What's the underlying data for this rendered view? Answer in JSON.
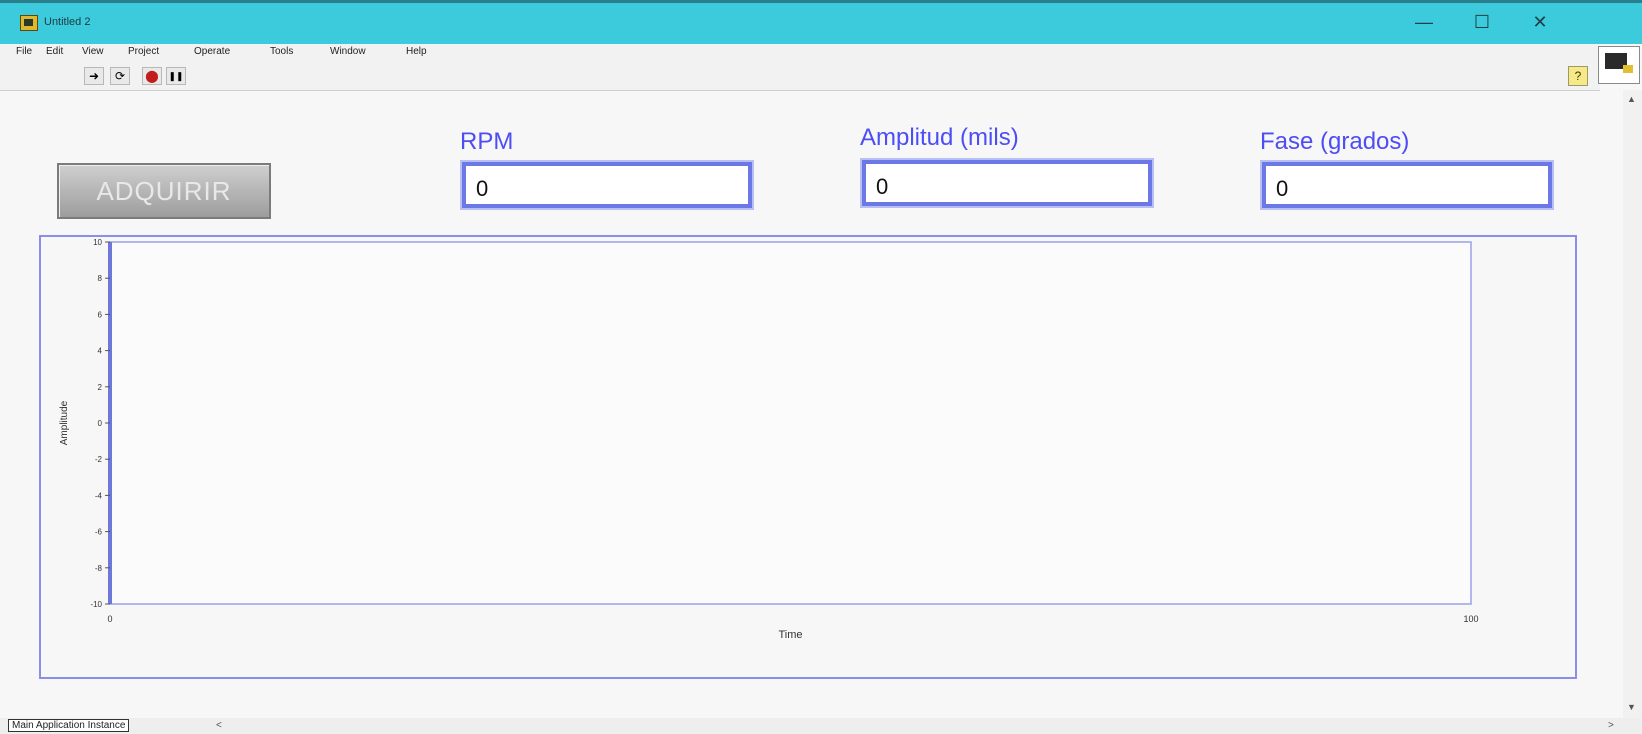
{
  "window": {
    "title": "Untitled 2",
    "minimize_glyph": "—",
    "maximize_glyph": "☐",
    "close_glyph": "✕"
  },
  "menu": [
    "File",
    "Edit",
    "View",
    "Project",
    "Operate",
    "Tools",
    "Window",
    "Help"
  ],
  "toolbar": {
    "run_glyph": "➜",
    "run_continuous_glyph": "⟳",
    "abort_glyph": "⬤",
    "pause_glyph": "❚❚",
    "help_glyph": "?"
  },
  "controls": {
    "acquire_label": "ADQUIRIR"
  },
  "indicators": [
    {
      "label": "RPM",
      "value": "0"
    },
    {
      "label": "Amplitud (mils)",
      "value": "0"
    },
    {
      "label": "Fase (grados)",
      "value": "0"
    }
  ],
  "chart_data": {
    "type": "line",
    "xlabel": "Time",
    "ylabel": "Amplitude",
    "xlim": [
      0,
      100
    ],
    "ylim": [
      -10,
      10
    ],
    "x_ticks": [
      "0",
      "100"
    ],
    "y_ticks": [
      "10",
      "8",
      "6",
      "4",
      "2",
      "0",
      "-2",
      "-4",
      "-6",
      "-8",
      "-10"
    ],
    "series": []
  },
  "statusbar": {
    "tab": "Main Application Instance",
    "left_arrow": "<",
    "right_arrow": ">"
  },
  "scroll": {
    "up": "▲",
    "down": "▼"
  }
}
